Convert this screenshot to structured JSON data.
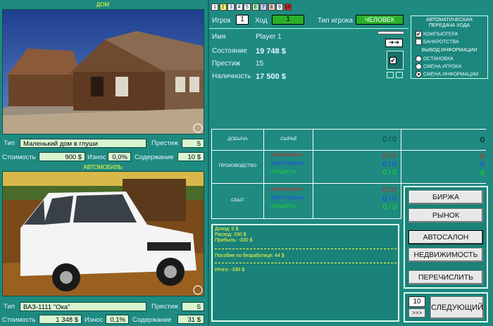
{
  "house": {
    "title": "ДОМ",
    "type_label": "Тип",
    "type_value": "Маленький дом в глуши",
    "prestige_label": "Престиж",
    "prestige_value": "5",
    "cost_label": "Стоимость",
    "cost_value": "900 $",
    "wear_label": "Износ",
    "wear_value": "0,0%",
    "upkeep_label": "Содержание",
    "upkeep_value": "10 $"
  },
  "car": {
    "title": "АВТОМОБИЛЬ",
    "type_label": "Тип",
    "type_value": "ВАЗ-1111 \"Ока\"",
    "prestige_label": "Престиж",
    "prestige_value": "5",
    "cost_label": "Стоимость",
    "cost_value": "1 348 $",
    "wear_label": "Износ",
    "wear_value": "0,1%",
    "upkeep_label": "Содержание",
    "upkeep_value": "31 $"
  },
  "top": {
    "player_numbers": [
      "1",
      "2",
      "3",
      "4",
      "5",
      "6",
      "7",
      "8",
      "9",
      "10"
    ],
    "player_colors": [
      "#ffffff",
      "#ffff66",
      "#ffffff",
      "#ffffff",
      "#ffffff",
      "#b0ffb0",
      "#ccccff",
      "#ffcccc",
      "#ffffff",
      "#dd2222"
    ],
    "player_label": "Игрок",
    "player_value": "1",
    "move_label": "Ход",
    "move_value": "1",
    "player_type_label": "Тип игрока",
    "player_type_value": "ЧЕЛОВЕК"
  },
  "player": {
    "name_label": "Имя",
    "name_value": "Player 1",
    "state_label": "Состояние",
    "state_value": "19 748 $",
    "prestige_label": "Престиж",
    "prestige_value": "15",
    "cash_label": "Наличность",
    "cash_value": "17 500 $"
  },
  "auto_panel": {
    "title1": "АВТОМАТИЧЕСКАЯ",
    "title2": "ПЕРЕДАЧА ХОДА",
    "opt_computer": "КОМПЬЮТЕРА",
    "opt_bankrupt": "БАНКРОТСТВА",
    "info_title": "ВЫВОД ИНФОРМАЦИИ",
    "info_stop": "ОСТАНОВКА",
    "info_player": "СМЕНА ИГРОКА",
    "info_change": "СМЕНА ИНФОРМАЦИИ"
  },
  "production": {
    "mining_label": "ДОБЫЧА",
    "raw_label": "СЫРЬЁ",
    "raw_frac": "0 / 0",
    "raw_total": "0",
    "production_label": "ПРОИЗВОДСТВО",
    "sales_label": "СБЫТ",
    "products": [
      "АВТОМОБИЛИ",
      "ЭЛЕКТРОНИКА",
      "ПРОДУКТЫ"
    ],
    "product_colors": [
      "#e02020",
      "#2040ff",
      "#20e020"
    ],
    "prod_fracs": [
      "0 / 0",
      "0 / 0",
      "0 / 0"
    ],
    "prod_totals": [
      "0",
      "0",
      "0"
    ],
    "sales_fracs": [
      "0 / 0",
      "0 / 0",
      "0 / 0"
    ]
  },
  "report": {
    "income": "Доход: 0 $",
    "expense": "Расход: 330 $",
    "profit": "Прибыль: -330 $",
    "benefit": "Пособие по безработице: 44 $",
    "total": "Итого: -330 $"
  },
  "buttons": {
    "exchange": "БИРЖА",
    "market": "РЫНОК",
    "car_shop": "АВТОСАЛОН",
    "real_estate": "НЕДВИЖИМОСТЬ",
    "transfer": "ПЕРЕЧИСЛИТЬ",
    "next": "СЛЕДУЮЩИЙ",
    "skip_count": "10",
    "skip_btn": ">>>"
  }
}
